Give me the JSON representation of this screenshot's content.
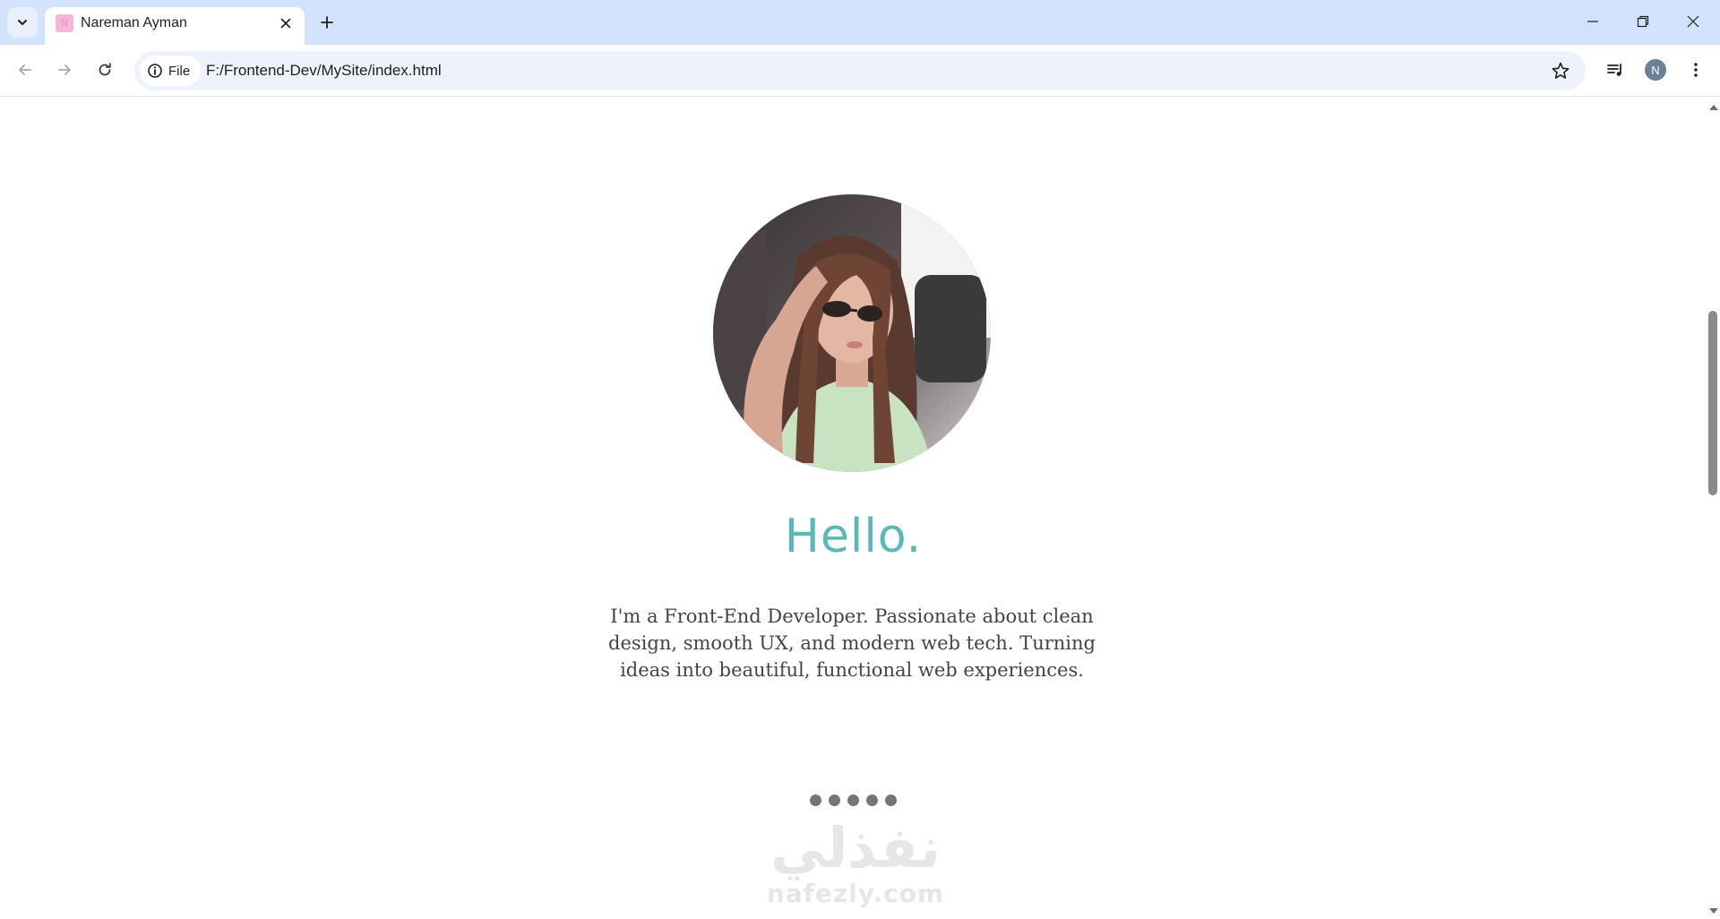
{
  "browser": {
    "tab": {
      "title": "Nareman Ayman",
      "favicon_letter": "N"
    },
    "address_bar": {
      "site_chip_label": "File",
      "url": "F:/Frontend-Dev/MySite/index.html"
    },
    "profile_initial": "N"
  },
  "page": {
    "heading": "Hello.",
    "intro": "I'm a Front-End Developer. Passionate about clean design, smooth UX, and modern web tech. Turning ideas into beautiful, functional web experiences.",
    "carousel_dot_count": 5
  },
  "watermark": {
    "arabic": "نفذلي",
    "latin": "nafezly.com"
  },
  "colors": {
    "accent": "#5ab8b7",
    "tabstrip": "#d3e3fd",
    "body_text": "#444444"
  }
}
